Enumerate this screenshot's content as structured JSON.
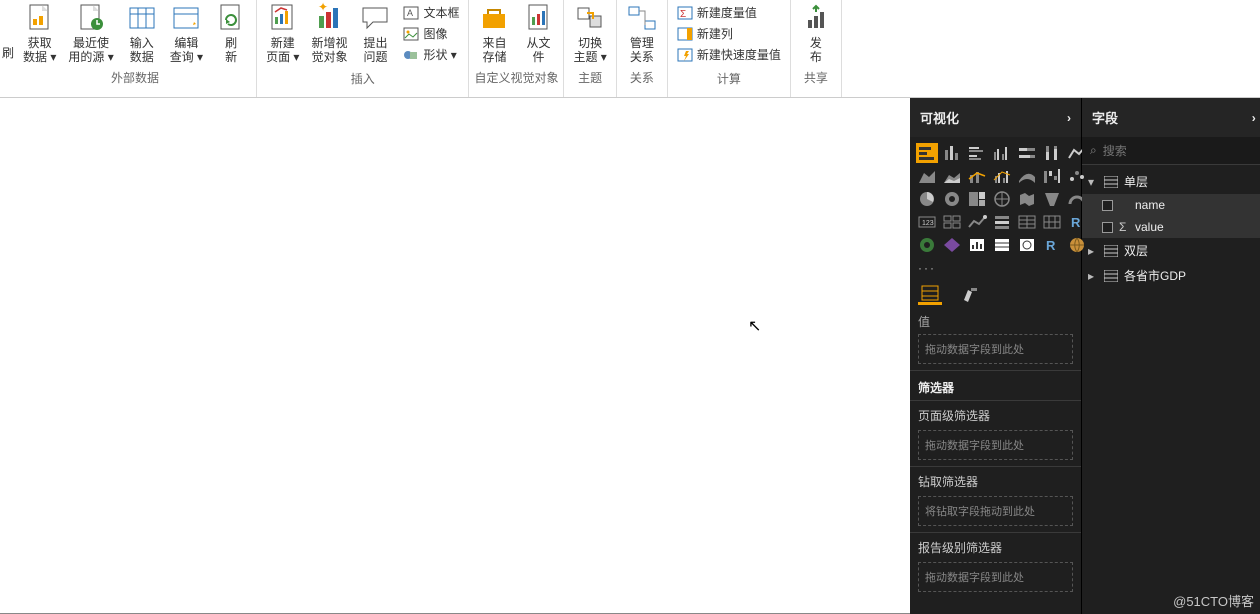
{
  "ribbon": {
    "groups": {
      "external_data": {
        "label": "外部数据",
        "get_data": "获取\n数据 ▾",
        "recent": "最近使\n用的源 ▾",
        "enter": "输入\n数据",
        "edit_query": "编辑\n查询 ▾",
        "refresh": "刷\n新"
      },
      "insert": {
        "label": "插入",
        "new_page": "新建\n页面 ▾",
        "new_visual": "新增视\n觉对象",
        "ask": "提出\n问题",
        "textbox": "文本框",
        "image": "图像",
        "shapes": "形状 ▾"
      },
      "custom": {
        "label": "自定义视觉对象",
        "from_store": "来自\n存储",
        "from_file": "从文\n件"
      },
      "theme": {
        "label": "主题",
        "switch": "切换\n主题 ▾"
      },
      "relation": {
        "label": "关系",
        "manage": "管理\n关系"
      },
      "calc": {
        "label": "计算",
        "new_measure": "新建度量值",
        "new_column": "新建列",
        "quick_measure": "新建快速度量值"
      },
      "share": {
        "label": "共享",
        "publish": "发\n布"
      }
    },
    "refresh_left": "刷"
  },
  "vis": {
    "title": "可视化",
    "value_label": "值",
    "drag_field": "拖动数据字段到此处",
    "filters_title": "筛选器",
    "page_filter": "页面级筛选器",
    "drill_filter": "钻取筛选器",
    "drill_drag": "将钻取字段拖动到此处",
    "report_filter": "报告级别筛选器",
    "drag_field2": "拖动数据字段到此处"
  },
  "fields": {
    "title": "字段",
    "search_placeholder": "搜索",
    "tables": [
      {
        "name": "单层",
        "expanded": true,
        "cols": [
          "name",
          "value"
        ],
        "sigma_on": [
          "value"
        ]
      },
      {
        "name": "双层",
        "expanded": false
      },
      {
        "name": "各省市GDP",
        "expanded": false
      }
    ]
  },
  "watermark": "@51CTO博客"
}
